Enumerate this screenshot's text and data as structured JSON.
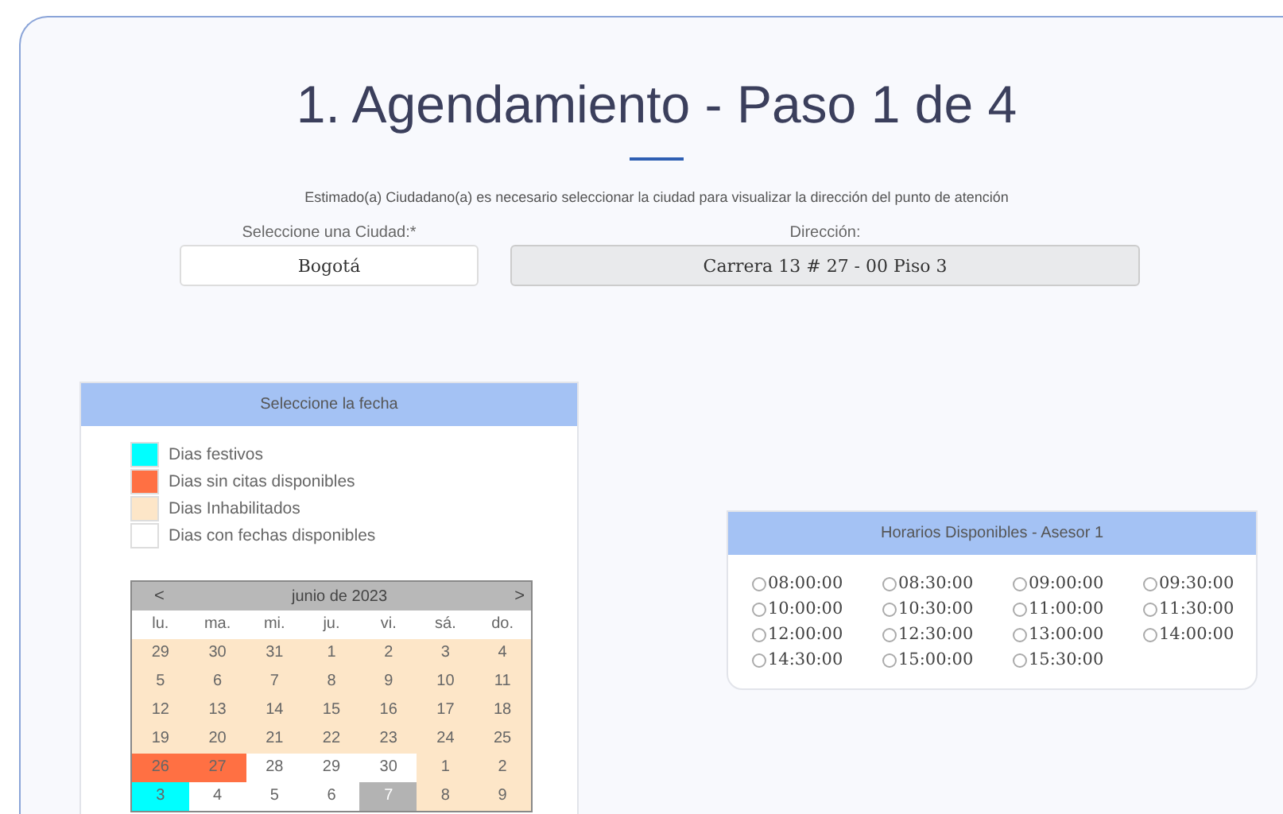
{
  "title": "1. Agendamiento - Paso 1 de 4",
  "intro": "Estimado(a) Ciudadano(a) es necesario seleccionar la ciudad para visualizar la dirección del punto de atención",
  "city_field": {
    "label": "Seleccione una Ciudad:*",
    "value": "Bogotá",
    "disabled": false
  },
  "address_field": {
    "label": "Dirección:",
    "value": "Carrera 13 # 27 - 00 Piso 3",
    "disabled": true
  },
  "date_panel": {
    "header": "Seleccione la fecha",
    "legend": [
      {
        "label": "Dias festivos",
        "color": "#00ffff"
      },
      {
        "label": "Dias sin citas disponibles",
        "color": "#ff7043"
      },
      {
        "label": "Dias Inhabilitados",
        "color": "#fde6c8"
      },
      {
        "label": "Dias con fechas disponibles",
        "color": "#ffffff"
      }
    ],
    "calendar": {
      "prev": "<",
      "month": "junio de 2023",
      "next": ">",
      "weekdays": [
        "lu.",
        "ma.",
        "mi.",
        "ju.",
        "vi.",
        "sá.",
        "do."
      ],
      "weeks": [
        [
          {
            "day": "29",
            "kind": "disabled",
            "selected": false
          },
          {
            "day": "30",
            "kind": "disabled",
            "selected": false
          },
          {
            "day": "31",
            "kind": "disabled",
            "selected": false
          },
          {
            "day": "1",
            "kind": "disabled",
            "selected": false
          },
          {
            "day": "2",
            "kind": "disabled",
            "selected": false
          },
          {
            "day": "3",
            "kind": "disabled",
            "selected": false
          },
          {
            "day": "4",
            "kind": "disabled",
            "selected": false
          }
        ],
        [
          {
            "day": "5",
            "kind": "disabled",
            "selected": false
          },
          {
            "day": "6",
            "kind": "disabled",
            "selected": false
          },
          {
            "day": "7",
            "kind": "disabled",
            "selected": false
          },
          {
            "day": "8",
            "kind": "disabled",
            "selected": false
          },
          {
            "day": "9",
            "kind": "disabled",
            "selected": false
          },
          {
            "day": "10",
            "kind": "disabled",
            "selected": false
          },
          {
            "day": "11",
            "kind": "disabled",
            "selected": false
          }
        ],
        [
          {
            "day": "12",
            "kind": "disabled",
            "selected": false
          },
          {
            "day": "13",
            "kind": "disabled",
            "selected": false
          },
          {
            "day": "14",
            "kind": "disabled",
            "selected": false
          },
          {
            "day": "15",
            "kind": "disabled",
            "selected": false
          },
          {
            "day": "16",
            "kind": "disabled",
            "selected": false
          },
          {
            "day": "17",
            "kind": "disabled",
            "selected": false
          },
          {
            "day": "18",
            "kind": "disabled",
            "selected": false
          }
        ],
        [
          {
            "day": "19",
            "kind": "disabled",
            "selected": false
          },
          {
            "day": "20",
            "kind": "disabled",
            "selected": false
          },
          {
            "day": "21",
            "kind": "disabled",
            "selected": false
          },
          {
            "day": "22",
            "kind": "disabled",
            "selected": false
          },
          {
            "day": "23",
            "kind": "disabled",
            "selected": false
          },
          {
            "day": "24",
            "kind": "disabled",
            "selected": false
          },
          {
            "day": "25",
            "kind": "disabled",
            "selected": false
          }
        ],
        [
          {
            "day": "26",
            "kind": "no_slots",
            "selected": false
          },
          {
            "day": "27",
            "kind": "no_slots",
            "selected": false
          },
          {
            "day": "28",
            "kind": "available",
            "selected": false
          },
          {
            "day": "29",
            "kind": "available",
            "selected": false
          },
          {
            "day": "30",
            "kind": "available",
            "selected": false
          },
          {
            "day": "1",
            "kind": "disabled",
            "selected": false
          },
          {
            "day": "2",
            "kind": "disabled",
            "selected": false
          }
        ],
        [
          {
            "day": "3",
            "kind": "holiday",
            "selected": false
          },
          {
            "day": "4",
            "kind": "available",
            "selected": false
          },
          {
            "day": "5",
            "kind": "available",
            "selected": false
          },
          {
            "day": "6",
            "kind": "available",
            "selected": false
          },
          {
            "day": "7",
            "kind": "available",
            "selected": true
          },
          {
            "day": "8",
            "kind": "disabled",
            "selected": false
          },
          {
            "day": "9",
            "kind": "disabled",
            "selected": false
          }
        ]
      ]
    }
  },
  "hours_panel": {
    "header": "Horarios Disponibles - Asesor 1",
    "slots": [
      {
        "label": "08:00:00",
        "selected": false
      },
      {
        "label": "08:30:00",
        "selected": false
      },
      {
        "label": "09:00:00",
        "selected": false
      },
      {
        "label": "09:30:00",
        "selected": false
      },
      {
        "label": "10:00:00",
        "selected": false
      },
      {
        "label": "10:30:00",
        "selected": false
      },
      {
        "label": "11:00:00",
        "selected": false
      },
      {
        "label": "11:30:00",
        "selected": false
      },
      {
        "label": "12:00:00",
        "selected": false
      },
      {
        "label": "12:30:00",
        "selected": false
      },
      {
        "label": "13:00:00",
        "selected": false
      },
      {
        "label": "14:00:00",
        "selected": false
      },
      {
        "label": "14:30:00",
        "selected": false
      },
      {
        "label": "15:00:00",
        "selected": false
      },
      {
        "label": "15:30:00",
        "selected": false
      }
    ]
  }
}
